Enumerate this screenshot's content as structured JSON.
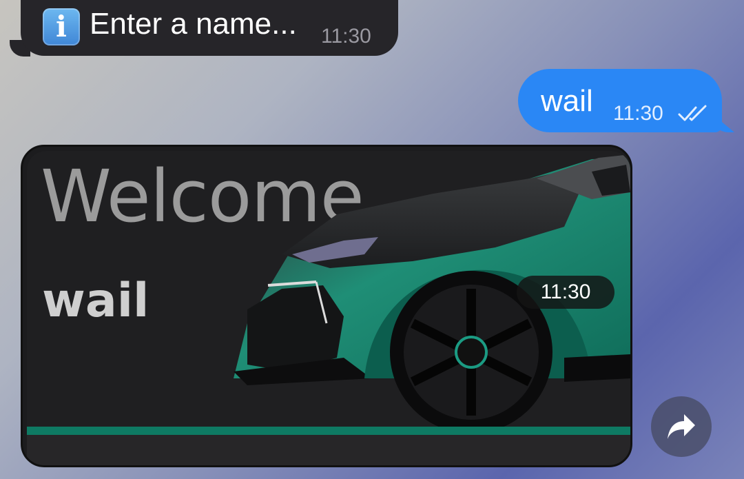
{
  "incoming_message": {
    "icon": "info-icon",
    "icon_glyph": "i",
    "text": "Enter a name...",
    "time": "11:30"
  },
  "outgoing_message": {
    "text": "wail",
    "time": "11:30",
    "status_icon": "double-check-icon"
  },
  "media_message": {
    "title": "Welcome",
    "name": "wail",
    "time": "11:30",
    "accent_color": "#0e7a63"
  },
  "actions": {
    "forward_icon": "forward-arrow-icon"
  },
  "colors": {
    "incoming_bubble": "#262529",
    "outgoing_bubble": "#2a87f5",
    "media_card": "#1c1c1e"
  }
}
